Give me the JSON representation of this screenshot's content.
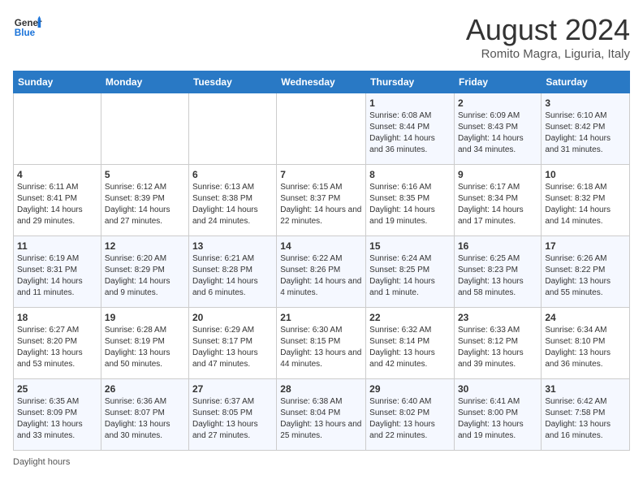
{
  "header": {
    "title": "August 2024",
    "location": "Romito Magra, Liguria, Italy",
    "logo_general": "General",
    "logo_blue": "Blue"
  },
  "columns": [
    "Sunday",
    "Monday",
    "Tuesday",
    "Wednesday",
    "Thursday",
    "Friday",
    "Saturday"
  ],
  "weeks": [
    [
      {
        "day": "",
        "text": ""
      },
      {
        "day": "",
        "text": ""
      },
      {
        "day": "",
        "text": ""
      },
      {
        "day": "",
        "text": ""
      },
      {
        "day": "1",
        "text": "Sunrise: 6:08 AM\nSunset: 8:44 PM\nDaylight: 14 hours and 36 minutes."
      },
      {
        "day": "2",
        "text": "Sunrise: 6:09 AM\nSunset: 8:43 PM\nDaylight: 14 hours and 34 minutes."
      },
      {
        "day": "3",
        "text": "Sunrise: 6:10 AM\nSunset: 8:42 PM\nDaylight: 14 hours and 31 minutes."
      }
    ],
    [
      {
        "day": "4",
        "text": "Sunrise: 6:11 AM\nSunset: 8:41 PM\nDaylight: 14 hours and 29 minutes."
      },
      {
        "day": "5",
        "text": "Sunrise: 6:12 AM\nSunset: 8:39 PM\nDaylight: 14 hours and 27 minutes."
      },
      {
        "day": "6",
        "text": "Sunrise: 6:13 AM\nSunset: 8:38 PM\nDaylight: 14 hours and 24 minutes."
      },
      {
        "day": "7",
        "text": "Sunrise: 6:15 AM\nSunset: 8:37 PM\nDaylight: 14 hours and 22 minutes."
      },
      {
        "day": "8",
        "text": "Sunrise: 6:16 AM\nSunset: 8:35 PM\nDaylight: 14 hours and 19 minutes."
      },
      {
        "day": "9",
        "text": "Sunrise: 6:17 AM\nSunset: 8:34 PM\nDaylight: 14 hours and 17 minutes."
      },
      {
        "day": "10",
        "text": "Sunrise: 6:18 AM\nSunset: 8:32 PM\nDaylight: 14 hours and 14 minutes."
      }
    ],
    [
      {
        "day": "11",
        "text": "Sunrise: 6:19 AM\nSunset: 8:31 PM\nDaylight: 14 hours and 11 minutes."
      },
      {
        "day": "12",
        "text": "Sunrise: 6:20 AM\nSunset: 8:29 PM\nDaylight: 14 hours and 9 minutes."
      },
      {
        "day": "13",
        "text": "Sunrise: 6:21 AM\nSunset: 8:28 PM\nDaylight: 14 hours and 6 minutes."
      },
      {
        "day": "14",
        "text": "Sunrise: 6:22 AM\nSunset: 8:26 PM\nDaylight: 14 hours and 4 minutes."
      },
      {
        "day": "15",
        "text": "Sunrise: 6:24 AM\nSunset: 8:25 PM\nDaylight: 14 hours and 1 minute."
      },
      {
        "day": "16",
        "text": "Sunrise: 6:25 AM\nSunset: 8:23 PM\nDaylight: 13 hours and 58 minutes."
      },
      {
        "day": "17",
        "text": "Sunrise: 6:26 AM\nSunset: 8:22 PM\nDaylight: 13 hours and 55 minutes."
      }
    ],
    [
      {
        "day": "18",
        "text": "Sunrise: 6:27 AM\nSunset: 8:20 PM\nDaylight: 13 hours and 53 minutes."
      },
      {
        "day": "19",
        "text": "Sunrise: 6:28 AM\nSunset: 8:19 PM\nDaylight: 13 hours and 50 minutes."
      },
      {
        "day": "20",
        "text": "Sunrise: 6:29 AM\nSunset: 8:17 PM\nDaylight: 13 hours and 47 minutes."
      },
      {
        "day": "21",
        "text": "Sunrise: 6:30 AM\nSunset: 8:15 PM\nDaylight: 13 hours and 44 minutes."
      },
      {
        "day": "22",
        "text": "Sunrise: 6:32 AM\nSunset: 8:14 PM\nDaylight: 13 hours and 42 minutes."
      },
      {
        "day": "23",
        "text": "Sunrise: 6:33 AM\nSunset: 8:12 PM\nDaylight: 13 hours and 39 minutes."
      },
      {
        "day": "24",
        "text": "Sunrise: 6:34 AM\nSunset: 8:10 PM\nDaylight: 13 hours and 36 minutes."
      }
    ],
    [
      {
        "day": "25",
        "text": "Sunrise: 6:35 AM\nSunset: 8:09 PM\nDaylight: 13 hours and 33 minutes."
      },
      {
        "day": "26",
        "text": "Sunrise: 6:36 AM\nSunset: 8:07 PM\nDaylight: 13 hours and 30 minutes."
      },
      {
        "day": "27",
        "text": "Sunrise: 6:37 AM\nSunset: 8:05 PM\nDaylight: 13 hours and 27 minutes."
      },
      {
        "day": "28",
        "text": "Sunrise: 6:38 AM\nSunset: 8:04 PM\nDaylight: 13 hours and 25 minutes."
      },
      {
        "day": "29",
        "text": "Sunrise: 6:40 AM\nSunset: 8:02 PM\nDaylight: 13 hours and 22 minutes."
      },
      {
        "day": "30",
        "text": "Sunrise: 6:41 AM\nSunset: 8:00 PM\nDaylight: 13 hours and 19 minutes."
      },
      {
        "day": "31",
        "text": "Sunrise: 6:42 AM\nSunset: 7:58 PM\nDaylight: 13 hours and 16 minutes."
      }
    ]
  ],
  "footer": {
    "daylight_label": "Daylight hours"
  }
}
